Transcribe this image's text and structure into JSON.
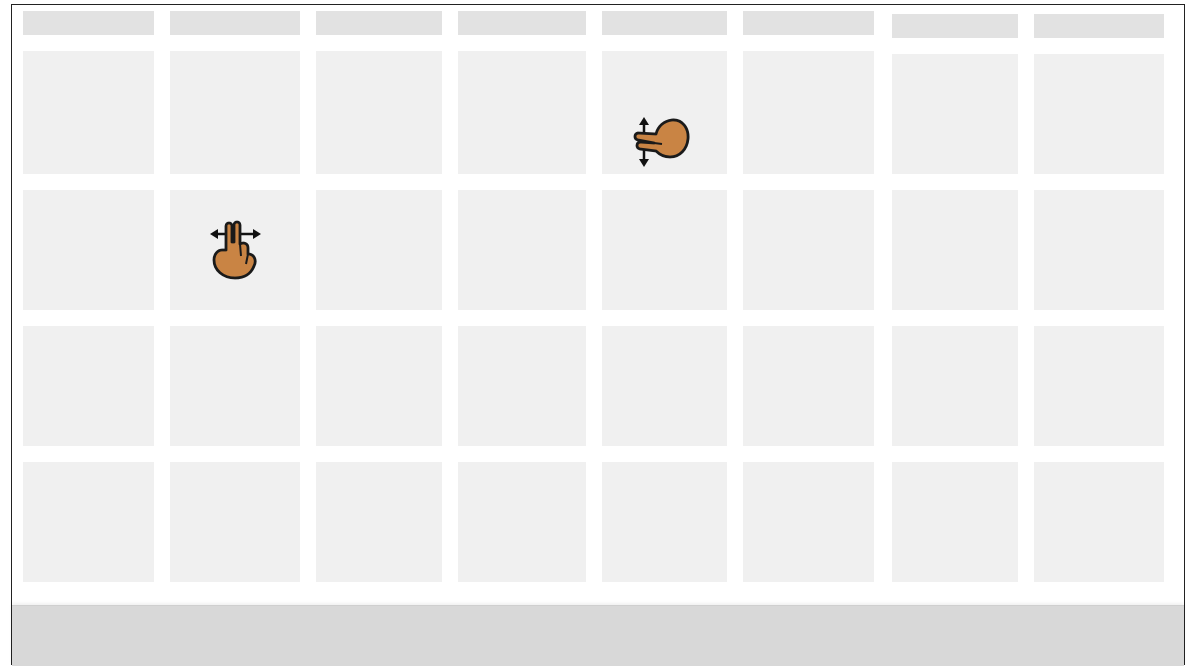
{
  "colors": {
    "header_cell": "#e2e2e2",
    "grid_cell": "#f0f0f0",
    "bottom_bar": "#d8d8d8",
    "frame_border": "#222222",
    "hand_fill": "#c98444",
    "hand_outline": "#1a1a1a"
  },
  "grid": {
    "columns": 8,
    "rows": 4,
    "header_row": true
  },
  "gestures": [
    {
      "icon": "two-finger-scroll-vertical-icon",
      "cell": "row-1-col-5"
    },
    {
      "icon": "two-finger-scroll-horizontal-icon",
      "cell": "row-2-col-2"
    }
  ]
}
